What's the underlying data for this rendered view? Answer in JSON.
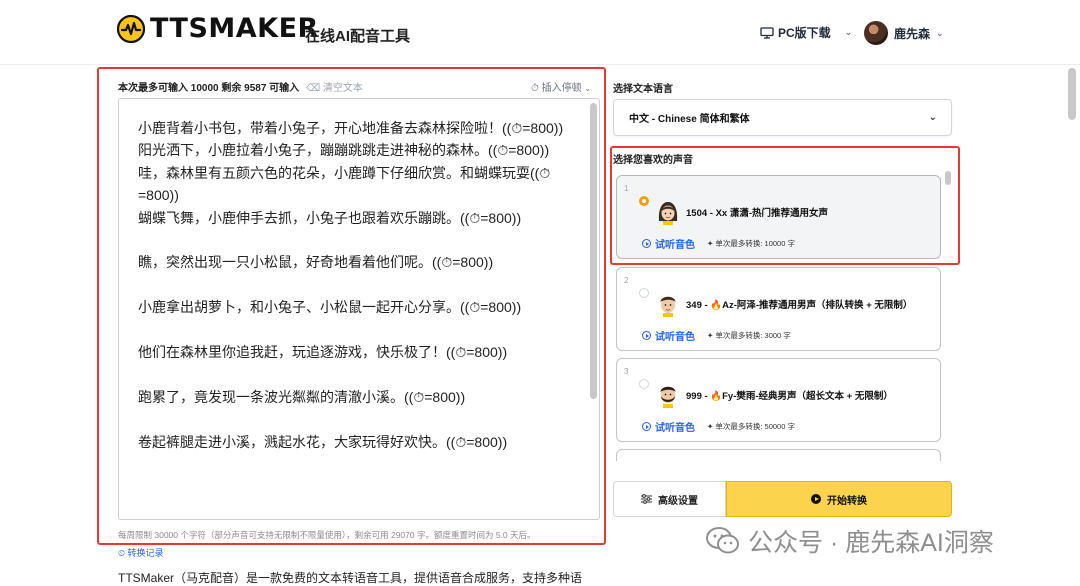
{
  "header": {
    "logo_text": "TTSMAKER",
    "slogan": "在线AI配音工具",
    "pc_download": "PC版下载",
    "user_name": "鹿先森"
  },
  "editor": {
    "limit_text": "本次最多可输入 10000 剩余 9587 可输入",
    "clear_text": "清空文本",
    "insert_pause": "插入停顿",
    "content": "小鹿背着小书包，带着小兔子，开心地准备去森林探险啦！((⏱=800))\n阳光洒下，小鹿拉着小兔子，蹦蹦跳跳走进神秘的森林。((⏱=800))\n哇，森林里有五颜六色的花朵，小鹿蹲下仔细欣赏。和蝴蝶玩耍((⏱=800))\n蝴蝶飞舞，小鹿伸手去抓，小兔子也跟着欢乐蹦跳。((⏱=800))\n\n瞧，突然出现一只小松鼠，好奇地看着他们呢。((⏱=800))\n\n小鹿拿出胡萝卜，和小兔子、小松鼠一起开心分享。((⏱=800))\n\n他们在森林里你追我赶，玩追逐游戏，快乐极了！((⏱=800))\n\n跑累了，竟发现一条波光粼粼的清澈小溪。((⏱=800))\n\n卷起裤腿走进小溪，溅起水花，大家玩得好欢快。((⏱=800))",
    "quota": "每周限制 30000 个字符（部分声音可支持无限制不限量使用），剩余可用 29070 字。额度重置时间为 5.0 天后。",
    "history": "转换记录",
    "intro": "TTSMaker（马克配音）是一款免费的文本转语音工具，提供语音合成服务，支持多种语"
  },
  "language": {
    "label": "选择文本语言",
    "selected": "中文 - Chinese 简体和繁体"
  },
  "voices": {
    "label": "选择您喜欢的声音",
    "listen_label": "试听音色",
    "items": [
      {
        "index": "1",
        "name": "1504 - Xx 潇潇-热门推荐通用女声",
        "limit": "单次最多转换: 10000 字",
        "selected": true
      },
      {
        "index": "2",
        "name": "349 - 🔥Az-阿泽-推荐通用男声（排队转换 + 无限制）",
        "limit": "单次最多转换: 3000 字",
        "selected": false
      },
      {
        "index": "3",
        "name": "999 - 🔥Fy-樊雨-经典男声（超长文本 + 无限制）",
        "limit": "单次最多转换: 50000 字",
        "selected": false
      }
    ]
  },
  "actions": {
    "advanced": "高级设置",
    "start": "开始转换"
  },
  "watermark": {
    "text": "公众号 · 鹿先森AI洞察"
  },
  "colors": {
    "accent_yellow": "#fcd34d",
    "link_blue": "#2563eb",
    "highlight_red": "#e53935",
    "selected_radio": "#f59e0b"
  }
}
